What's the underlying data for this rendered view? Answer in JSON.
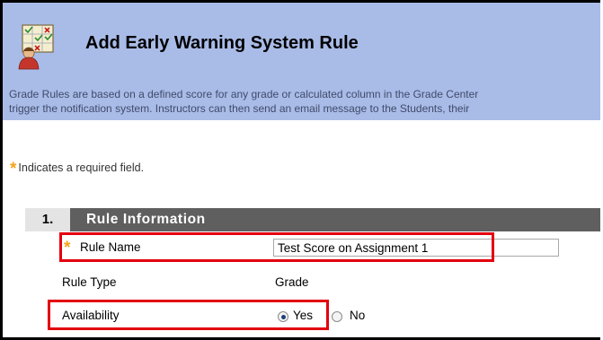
{
  "header": {
    "title": "Add Early Warning System Rule",
    "description_line1": "Grade Rules are based on a defined score for any grade or calculated column in the Grade Center",
    "description_line2": "trigger the notification system. Instructors can then send an email message to the Students, their"
  },
  "icons": {
    "header": "gradebook-person-icon",
    "required": "asterisk-icon"
  },
  "required_note": {
    "star": "*",
    "text": "Indicates a required field."
  },
  "section": {
    "number": "1.",
    "title": "Rule Information"
  },
  "fields": {
    "rule_name": {
      "label": "Rule Name",
      "value": "Test Score on Assignment 1"
    },
    "rule_type": {
      "label": "Rule Type",
      "value": "Grade"
    },
    "availability": {
      "label": "Availability",
      "options": [
        {
          "label": "Yes",
          "selected": true
        },
        {
          "label": "No",
          "selected": false
        }
      ]
    }
  },
  "colors": {
    "header_bg": "#a9bbe7",
    "section_bar": "#5f5f5f",
    "highlight": "#e3000f",
    "required_star": "#f6a31b"
  }
}
